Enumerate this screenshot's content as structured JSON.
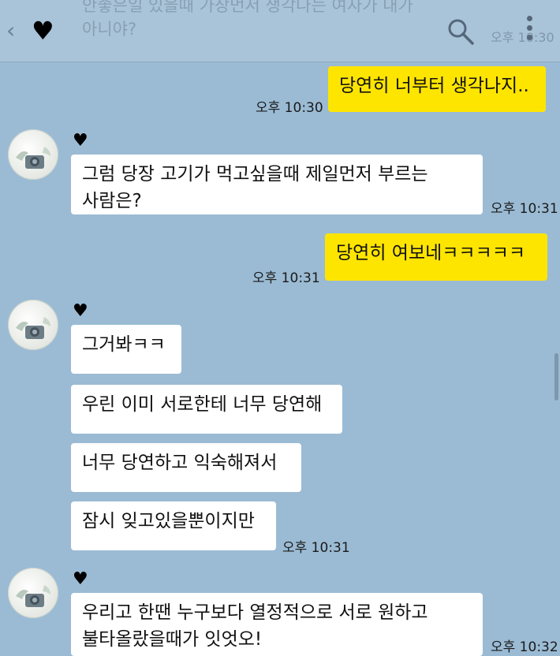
{
  "header": {
    "back_glyph": "‹",
    "title": "♥",
    "faded_previous_message": "안좋은일 있을때 가장먼저 생각나는 여자가 내가\n아니야?",
    "faded_previous_time": "오후 10:30",
    "icons": [
      "back-chevron-icon",
      "search-icon",
      "more-vertical-icon"
    ]
  },
  "chat": {
    "contact_name": "♥",
    "messages": [
      {
        "from": "me",
        "text": "당연히 너부터 생각나지..",
        "time": "오후 10:30"
      },
      {
        "from": "contact",
        "text": "그럼 당장 고기가 먹고싶을때 제일먼저 부르는\n사람은?",
        "time": "오후 10:31"
      },
      {
        "from": "me",
        "text": "당연히 여보네ㅋㅋㅋㅋㅋ",
        "time": "오후 10:31"
      },
      {
        "from": "contact",
        "text": "그거봐ㅋㅋ"
      },
      {
        "from": "contact",
        "text": "우린 이미 서로한테 너무 당연해"
      },
      {
        "from": "contact",
        "text": "너무 당연하고 익숙해져서"
      },
      {
        "from": "contact",
        "text": "잠시 잊고있을뿐이지만",
        "time": "오후 10:31"
      },
      {
        "from": "contact",
        "text": "우리고 한땐 누구보다 열정적으로 서로 원하고\n불타올랐을때가 잇엇오!",
        "time": "오후 10:32"
      }
    ]
  },
  "colors": {
    "background": "#9bbbd4",
    "my_bubble": "#fee500",
    "their_bubble": "#ffffff"
  }
}
